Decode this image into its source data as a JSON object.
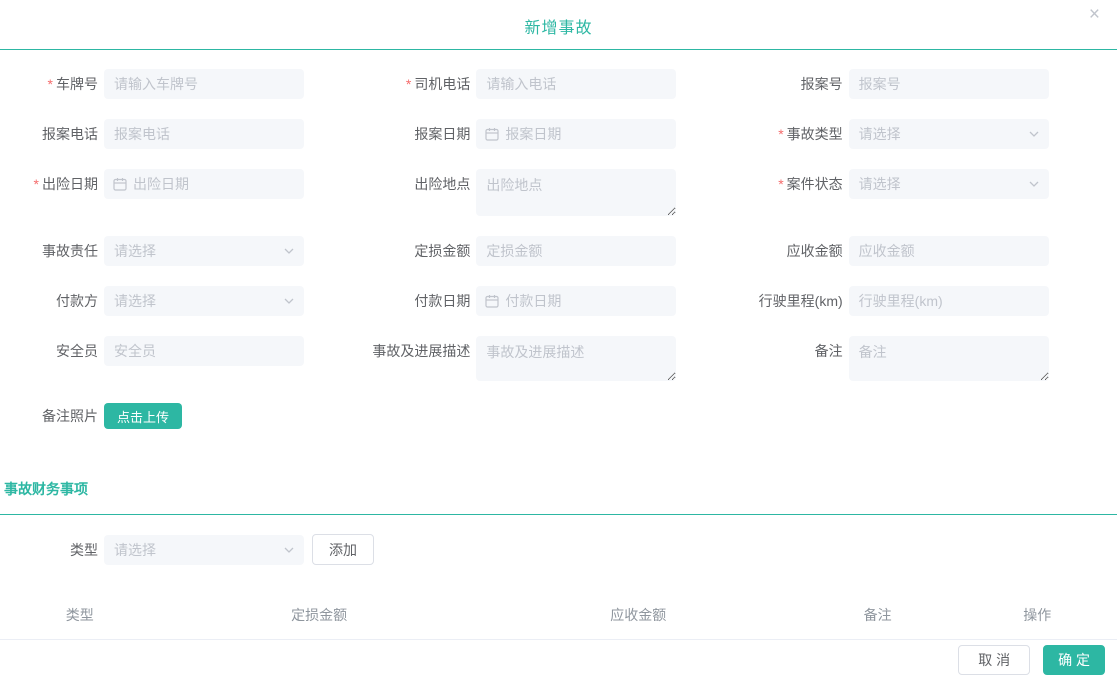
{
  "dialog": {
    "title": "新增事故",
    "close_icon": "×"
  },
  "colors": {
    "accent": "#2db7a3",
    "required": "#f56c6c",
    "input_bg": "#f5f7fa",
    "placeholder": "#c0c4cc"
  },
  "form": {
    "required_marker": "*",
    "fields": [
      {
        "label": "车牌号",
        "required": true,
        "type": "input",
        "placeholder": "请输入车牌号"
      },
      {
        "label": "司机电话",
        "required": true,
        "type": "input",
        "placeholder": "请输入电话"
      },
      {
        "label": "报案号",
        "required": false,
        "type": "input",
        "placeholder": "报案号"
      },
      {
        "label": "报案电话",
        "required": false,
        "type": "input",
        "placeholder": "报案电话"
      },
      {
        "label": "报案日期",
        "required": false,
        "type": "date",
        "placeholder": "报案日期"
      },
      {
        "label": "事故类型",
        "required": true,
        "type": "select",
        "placeholder": "请选择"
      },
      {
        "label": "出险日期",
        "required": true,
        "type": "date",
        "placeholder": "出险日期"
      },
      {
        "label": "出险地点",
        "required": false,
        "type": "textarea",
        "placeholder": "出险地点"
      },
      {
        "label": "案件状态",
        "required": true,
        "type": "select",
        "placeholder": "请选择"
      },
      {
        "label": "事故责任",
        "required": false,
        "type": "select",
        "placeholder": "请选择"
      },
      {
        "label": "定损金额",
        "required": false,
        "type": "input",
        "placeholder": "定损金额"
      },
      {
        "label": "应收金额",
        "required": false,
        "type": "input",
        "placeholder": "应收金额"
      },
      {
        "label": "付款方",
        "required": false,
        "type": "select",
        "placeholder": "请选择"
      },
      {
        "label": "付款日期",
        "required": false,
        "type": "date",
        "placeholder": "付款日期"
      },
      {
        "label": "行驶里程(km)",
        "required": false,
        "type": "input",
        "placeholder": "行驶里程(km)"
      },
      {
        "label": "安全员",
        "required": false,
        "type": "input",
        "placeholder": "安全员"
      },
      {
        "label": "事故及进展描述",
        "required": false,
        "type": "textarea",
        "placeholder": "事故及进展描述"
      },
      {
        "label": "备注",
        "required": false,
        "type": "textarea",
        "placeholder": "备注"
      }
    ],
    "upload": {
      "label": "备注照片",
      "button_label": "点击上传"
    }
  },
  "finance": {
    "section_title": "事故财务事项",
    "type_label": "类型",
    "type_placeholder": "请选择",
    "add_button_label": "添加",
    "table_headers": [
      "类型",
      "定损金额",
      "应收金额",
      "备注",
      "操作"
    ]
  },
  "footer": {
    "cancel_label": "取 消",
    "confirm_label": "确 定"
  }
}
